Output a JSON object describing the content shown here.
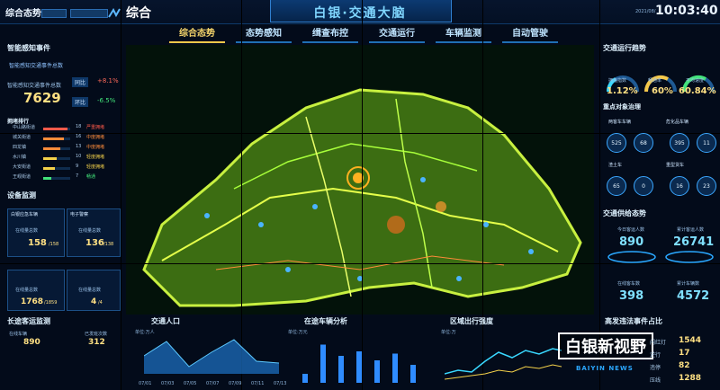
{
  "header": {
    "left_title": "综合态势",
    "logo_text": "综合",
    "main_title": "白银·交通大脑",
    "date_text": "2021/08/",
    "time": "10:03:40"
  },
  "nav": [
    "综合态势",
    "态势感知",
    "缉查布控",
    "交通运行",
    "车辆监测",
    "自动管驶"
  ],
  "left": {
    "events_title": "智能感知事件",
    "events_sub": "智能感知交通事件总数",
    "events_total_label": "智能感知交通事件总数",
    "events_total": "7629",
    "yoy_label": "同比",
    "yoy_value": "+8.1%",
    "mom_label": "环比",
    "mom_value": "-6.5%",
    "rank_title": "拥堵排行",
    "rank_rows": [
      {
        "name": "中山路街道",
        "num": "18",
        "level": "严重拥堵",
        "color": "#ff5a4a",
        "pct": 0.9
      },
      {
        "name": "城关街道",
        "num": "16",
        "level": "中度拥堵",
        "color": "#ff8c3a",
        "pct": 0.75
      },
      {
        "name": "四龙镇",
        "num": "13",
        "level": "中度拥堵",
        "color": "#ff8c3a",
        "pct": 0.62
      },
      {
        "name": "水川镇",
        "num": "10",
        "level": "轻度拥堵",
        "color": "#f5d24a",
        "pct": 0.5
      },
      {
        "name": "大安街道",
        "num": "9",
        "level": "轻度拥堵",
        "color": "#f5d24a",
        "pct": 0.42
      },
      {
        "name": "王岘街道",
        "num": "7",
        "level": "畅通",
        "color": "#42e37a",
        "pct": 0.3
      }
    ],
    "device_title": "设备监测",
    "dev1_title": "白银应急车辆",
    "dev1_label": "在线量总数",
    "dev1_value": "158",
    "dev1_total": "/158",
    "dev2_title": "电子警察",
    "dev2_label": "在线量总数",
    "dev2_value": "136",
    "dev2_total": "/138",
    "dev3_label": "在线量总数",
    "dev3_value": "1768",
    "dev3_total": "/1859",
    "dev4_label": "在线量总数",
    "dev4_value": "4",
    "dev4_total": "/4",
    "bus_title": "长途客运监测",
    "bus_a_label": "在线车辆",
    "bus_a_value": "890",
    "bus_b_label": "已发班次数",
    "bus_b_value": "312"
  },
  "bottom": {
    "people_title": "交通人口",
    "people_unit": "单位:万人",
    "people_ticks": [
      "07/01",
      "07/03",
      "07/05",
      "07/07",
      "07/09",
      "07/11",
      "07/13"
    ],
    "vehicle_title": "在途车辆分析",
    "vehicle_unit": "单位:万元",
    "flow_title": "区域出行强度",
    "flow_unit": "单位:万"
  },
  "right": {
    "traffic_title": "交通运行趋势",
    "g1_label": "拥堵指数",
    "g1_value": "1.12%",
    "g2_label": "畅通率",
    "g2_value": "60%",
    "g3_label": "平均速度",
    "g3_value": "60.84%",
    "focus_title": "重点对象治理",
    "f1": "两客车车辆",
    "f2": "危化品车辆",
    "f1_vals": [
      "525",
      "68",
      "395",
      "11"
    ],
    "f3": "渣土车",
    "f4": "重型货车",
    "f2_vals": [
      "65",
      "0",
      "16",
      "23"
    ],
    "supply_title": "交通供给态势",
    "s1_label": "今日客运人数",
    "s1_value": "890",
    "s2_label": "累计客运人数",
    "s2_value": "26741",
    "s3_label": "在线客车数",
    "s3_value": "398",
    "s4_label": "累计车辆数",
    "s4_value": "4572",
    "illegal_title": "高发违法事件占比",
    "illegal_rows": [
      {
        "label": "闯红灯",
        "value": "1544"
      },
      {
        "label": "逆行",
        "value": "17"
      },
      {
        "label": "违停",
        "value": "82"
      },
      {
        "label": "压线",
        "value": "1288"
      }
    ]
  },
  "overlay": {
    "watermark": "白银新视野",
    "watermark_en": "BAIYIN NEWS"
  },
  "chart_data": [
    {
      "type": "area",
      "categories": [
        "07/01",
        "07/03",
        "07/05",
        "07/07",
        "07/09",
        "07/11",
        "07/13"
      ],
      "values": [
        0.5,
        0.9,
        0.2,
        0.6,
        0.95,
        0.35,
        0.3
      ]
    },
    {
      "type": "bar",
      "values": [
        0.2,
        0.85,
        0.6,
        0.7,
        0.5,
        0.65,
        0.4
      ]
    }
  ]
}
